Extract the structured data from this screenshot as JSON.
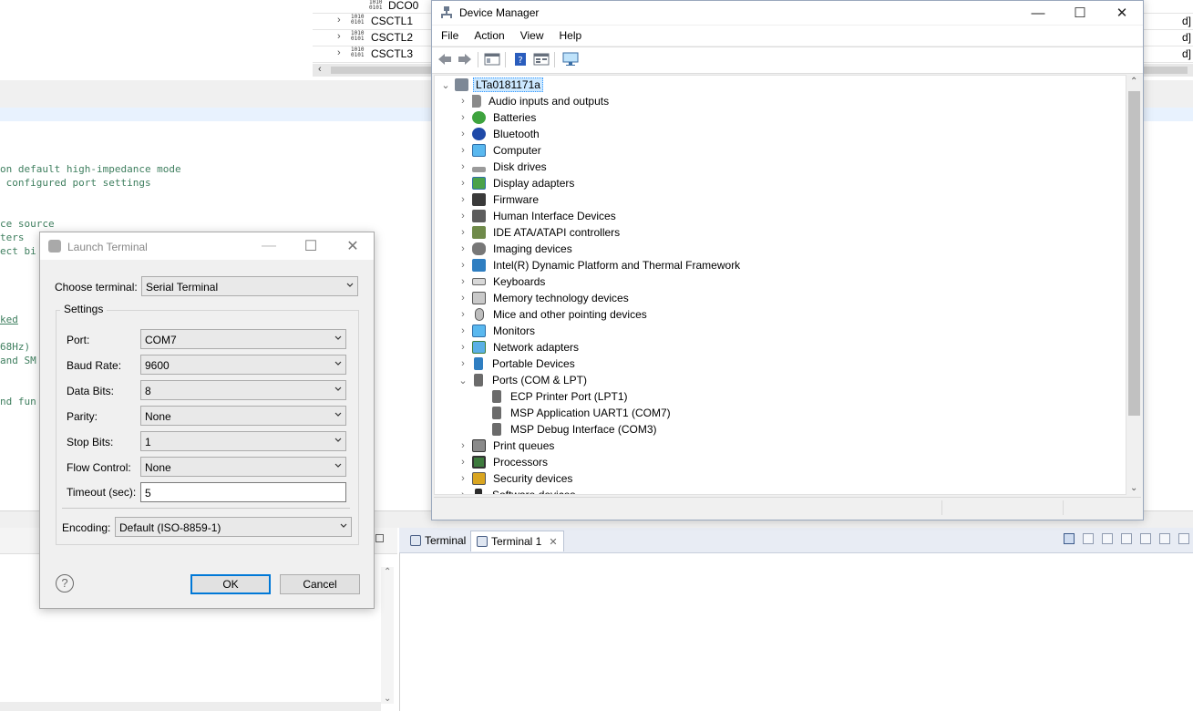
{
  "registers": {
    "rows": [
      {
        "name": "DCO0",
        "tail": ""
      },
      {
        "name": "CSCTL1",
        "tail": "d]"
      },
      {
        "name": "CSCTL2",
        "tail": "d]"
      },
      {
        "name": "CSCTL3",
        "tail": "d]"
      }
    ],
    "bits_icon": "1010\n0101"
  },
  "editor": {
    "lines": [
      "on default high-impedance mode",
      " configured port settings",
      "ce source",
      "ters",
      "ect bi",
      "ked",
      "68Hz) ",
      "and SM",
      "nd fun"
    ]
  },
  "terminal_view": {
    "tabs": [
      {
        "label": "Terminal",
        "active": false
      },
      {
        "label": "Terminal 1",
        "active": true
      }
    ]
  },
  "launch_terminal": {
    "title": "Launch Terminal",
    "choose_label": "Choose terminal:",
    "choose_value": "Serial Terminal",
    "settings_label": "Settings",
    "fields": [
      {
        "label": "Port:",
        "value": "COM7"
      },
      {
        "label": "Baud Rate:",
        "value": "9600"
      },
      {
        "label": "Data Bits:",
        "value": "8"
      },
      {
        "label": "Parity:",
        "value": "None"
      },
      {
        "label": "Stop Bits:",
        "value": "1"
      },
      {
        "label": "Flow Control:",
        "value": "None"
      }
    ],
    "timeout_label": "Timeout (sec):",
    "timeout_value": "5",
    "encoding_label": "Encoding:",
    "encoding_value": "Default (ISO-8859-1)",
    "help_glyph": "?",
    "ok": "OK",
    "cancel": "Cancel"
  },
  "device_manager": {
    "title": "Device Manager",
    "menu": [
      "File",
      "Action",
      "View",
      "Help"
    ],
    "root": "LTa0181171a",
    "categories": [
      {
        "label": "Audio inputs and outputs",
        "icon": "speaker-icon"
      },
      {
        "label": "Batteries",
        "icon": "battery-icon"
      },
      {
        "label": "Bluetooth",
        "icon": "bluetooth-icon"
      },
      {
        "label": "Computer",
        "icon": "monitor-icon"
      },
      {
        "label": "Disk drives",
        "icon": "disk-drive-icon"
      },
      {
        "label": "Display adapters",
        "icon": "display-adapter-icon"
      },
      {
        "label": "Firmware",
        "icon": "chip-icon"
      },
      {
        "label": "Human Interface Devices",
        "icon": "hid-icon"
      },
      {
        "label": "IDE ATA/ATAPI controllers",
        "icon": "ide-icon"
      },
      {
        "label": "Imaging devices",
        "icon": "camera-icon"
      },
      {
        "label": "Intel(R) Dynamic Platform and Thermal Framework",
        "icon": "intel-icon"
      },
      {
        "label": "Keyboards",
        "icon": "keyboard-icon"
      },
      {
        "label": "Memory technology devices",
        "icon": "memory-icon"
      },
      {
        "label": "Mice and other pointing devices",
        "icon": "mouse-icon"
      },
      {
        "label": "Monitors",
        "icon": "monitor-icon"
      },
      {
        "label": "Network adapters",
        "icon": "network-icon"
      },
      {
        "label": "Portable Devices",
        "icon": "portable-device-icon"
      },
      {
        "label": "Ports (COM & LPT)",
        "icon": "port-icon",
        "expanded": true,
        "children": [
          "ECP Printer Port (LPT1)",
          "MSP Application UART1 (COM7)",
          "MSP Debug Interface (COM3)"
        ]
      },
      {
        "label": "Print queues",
        "icon": "printer-icon"
      },
      {
        "label": "Processors",
        "icon": "processor-icon"
      },
      {
        "label": "Security devices",
        "icon": "security-icon"
      },
      {
        "label": "Software devices",
        "icon": "software-icon"
      }
    ]
  },
  "colors": {
    "accent": "#0078d7",
    "selection": "#cce8ff",
    "comment_green": "#3f7f5f",
    "tab_bar": "#e8ecf4"
  }
}
